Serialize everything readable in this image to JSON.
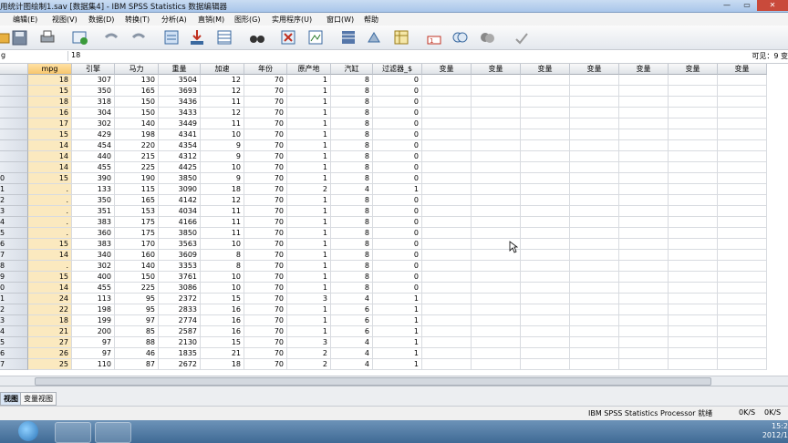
{
  "window": {
    "title": "用统计图绘制1.sav [数据集4] - IBM SPSS Statistics 数据编辑器",
    "minimize": "—",
    "maximize": "▭",
    "close": "✕"
  },
  "menu": [
    "编辑(E)",
    "视图(V)",
    "数据(D)",
    "转换(T)",
    "分析(A)",
    "直销(M)",
    "图形(G)",
    "实用程序(U)",
    "窗口(W)",
    "帮助"
  ],
  "toolbar_icons": [
    "open-icon",
    "save-icon",
    "print-icon",
    "dialog-recall-icon",
    "undo-icon",
    "redo-icon",
    "goto-case-icon",
    "goto-variable-icon",
    "variables-icon",
    "find-icon",
    "split-file-icon",
    "weight-cases-icon",
    "select-cases-icon",
    "insert-cases-icon",
    "insert-variable-icon",
    "value-labels-icon",
    "use-sets-icon",
    "spell-check-icon"
  ],
  "cellbar": {
    "reference": "g",
    "value": "18",
    "visible": "可见：9 变"
  },
  "columns": [
    "mpg",
    "引擎",
    "马力",
    "重量",
    "加速",
    "年份",
    "原产地",
    "汽缸",
    "过滤器_$",
    "变量",
    "变量",
    "变量",
    "变量",
    "变量",
    "变量",
    "变量"
  ],
  "row_labels": [
    "",
    "",
    "",
    "",
    "",
    "",
    "",
    "",
    "",
    "0",
    "1",
    "2",
    "3",
    "4",
    "5",
    "6",
    "7",
    "8",
    "9",
    "0",
    "1",
    "2",
    "3",
    "4",
    "5",
    "6",
    "7"
  ],
  "rows": [
    [
      "18",
      "307",
      "130",
      "3504",
      "12",
      "70",
      "1",
      "8",
      "0"
    ],
    [
      "15",
      "350",
      "165",
      "3693",
      "12",
      "70",
      "1",
      "8",
      "0"
    ],
    [
      "18",
      "318",
      "150",
      "3436",
      "11",
      "70",
      "1",
      "8",
      "0"
    ],
    [
      "16",
      "304",
      "150",
      "3433",
      "12",
      "70",
      "1",
      "8",
      "0"
    ],
    [
      "17",
      "302",
      "140",
      "3449",
      "11",
      "70",
      "1",
      "8",
      "0"
    ],
    [
      "15",
      "429",
      "198",
      "4341",
      "10",
      "70",
      "1",
      "8",
      "0"
    ],
    [
      "14",
      "454",
      "220",
      "4354",
      "9",
      "70",
      "1",
      "8",
      "0"
    ],
    [
      "14",
      "440",
      "215",
      "4312",
      "9",
      "70",
      "1",
      "8",
      "0"
    ],
    [
      "14",
      "455",
      "225",
      "4425",
      "10",
      "70",
      "1",
      "8",
      "0"
    ],
    [
      "15",
      "390",
      "190",
      "3850",
      "9",
      "70",
      "1",
      "8",
      "0"
    ],
    [
      ".",
      "133",
      "115",
      "3090",
      "18",
      "70",
      "2",
      "4",
      "1"
    ],
    [
      ".",
      "350",
      "165",
      "4142",
      "12",
      "70",
      "1",
      "8",
      "0"
    ],
    [
      ".",
      "351",
      "153",
      "4034",
      "11",
      "70",
      "1",
      "8",
      "0"
    ],
    [
      ".",
      "383",
      "175",
      "4166",
      "11",
      "70",
      "1",
      "8",
      "0"
    ],
    [
      ".",
      "360",
      "175",
      "3850",
      "11",
      "70",
      "1",
      "8",
      "0"
    ],
    [
      "15",
      "383",
      "170",
      "3563",
      "10",
      "70",
      "1",
      "8",
      "0"
    ],
    [
      "14",
      "340",
      "160",
      "3609",
      "8",
      "70",
      "1",
      "8",
      "0"
    ],
    [
      ".",
      "302",
      "140",
      "3353",
      "8",
      "70",
      "1",
      "8",
      "0"
    ],
    [
      "15",
      "400",
      "150",
      "3761",
      "10",
      "70",
      "1",
      "8",
      "0"
    ],
    [
      "14",
      "455",
      "225",
      "3086",
      "10",
      "70",
      "1",
      "8",
      "0"
    ],
    [
      "24",
      "113",
      "95",
      "2372",
      "15",
      "70",
      "3",
      "4",
      "1"
    ],
    [
      "22",
      "198",
      "95",
      "2833",
      "16",
      "70",
      "1",
      "6",
      "1"
    ],
    [
      "18",
      "199",
      "97",
      "2774",
      "16",
      "70",
      "1",
      "6",
      "1"
    ],
    [
      "21",
      "200",
      "85",
      "2587",
      "16",
      "70",
      "1",
      "6",
      "1"
    ],
    [
      "27",
      "97",
      "88",
      "2130",
      "15",
      "70",
      "3",
      "4",
      "1"
    ],
    [
      "26",
      "97",
      "46",
      "1835",
      "21",
      "70",
      "2",
      "4",
      "1"
    ],
    [
      "25",
      "110",
      "87",
      "2672",
      "18",
      "70",
      "2",
      "4",
      "1"
    ]
  ],
  "tabs": {
    "data_view": "视图",
    "variable_view": "变量视图"
  },
  "status": {
    "processor": "IBM SPSS Statistics Processor 就绪",
    "net": "0K/S",
    "net2": "0K/S"
  },
  "clock": {
    "time": "15:2",
    "date": "2012/1"
  },
  "colors": {
    "mpg_highlight": "#fbe9bf",
    "header": "#dfe3e8"
  }
}
